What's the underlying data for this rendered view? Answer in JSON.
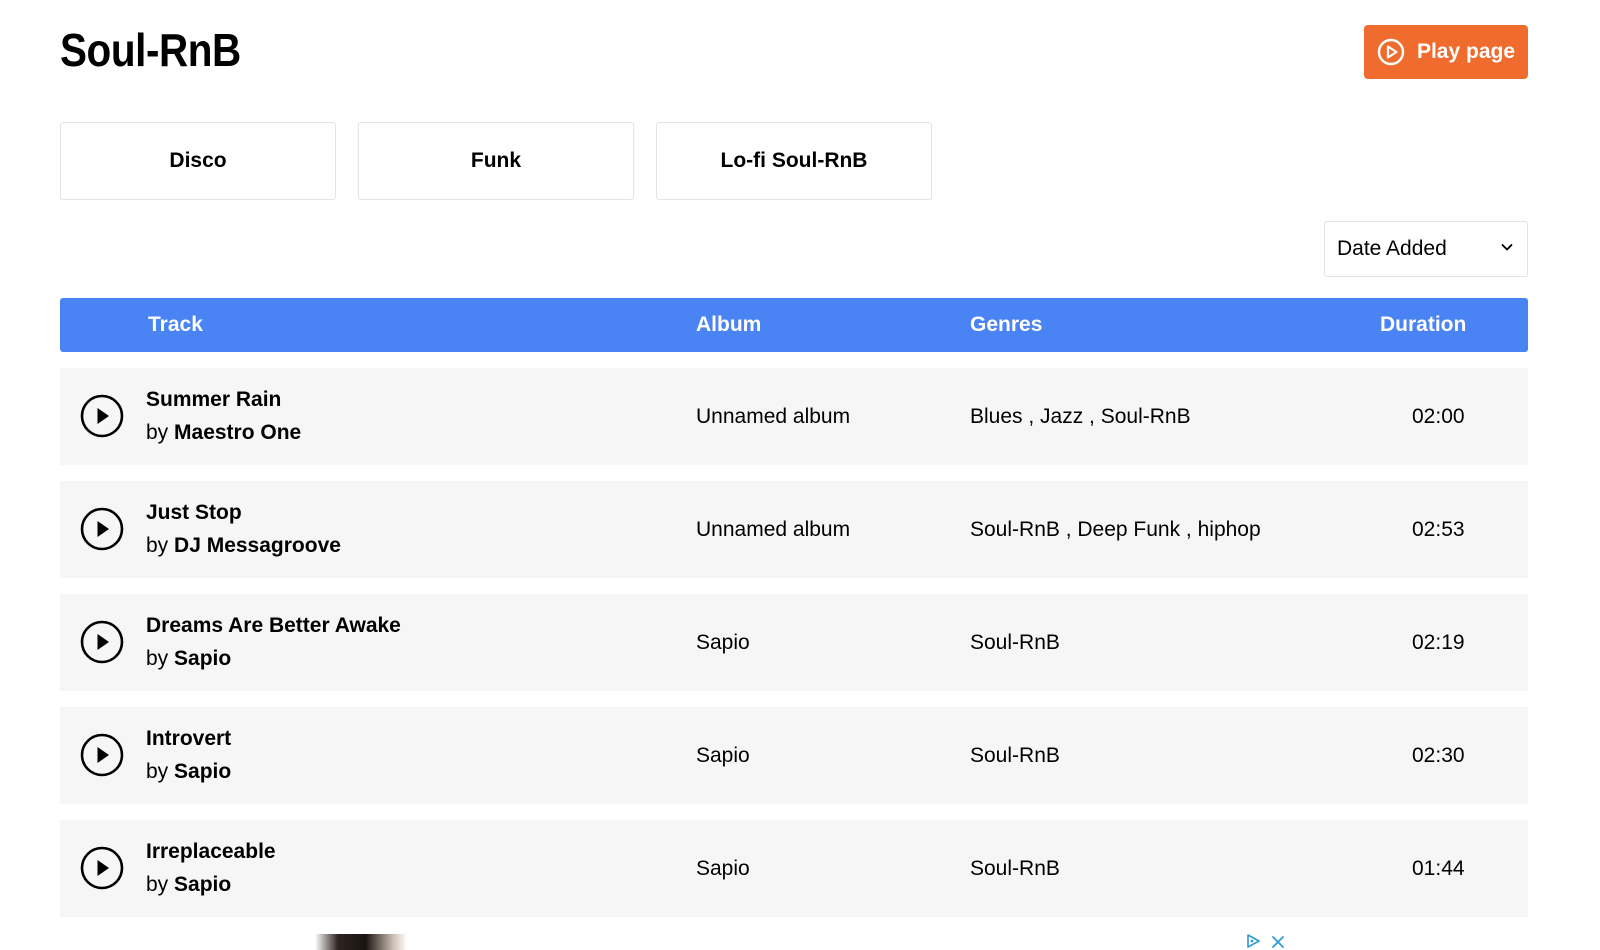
{
  "page": {
    "title": "Soul-RnB",
    "play_button_label": "Play page"
  },
  "genre_tiles": [
    "Disco",
    "Funk",
    "Lo-fi Soul-RnB"
  ],
  "sort": {
    "selected": "Date Added"
  },
  "table": {
    "columns": {
      "track": "Track",
      "album": "Album",
      "genres": "Genres",
      "duration": "Duration"
    },
    "rows": [
      {
        "track": "Summer Rain",
        "by": "by",
        "artist": "Maestro One",
        "album": "Unnamed album",
        "genres": "Blues , Jazz , Soul-RnB",
        "duration": "02:00"
      },
      {
        "track": "Just Stop",
        "by": "by",
        "artist": "DJ Messagroove",
        "album": "Unnamed album",
        "genres": "Soul-RnB , Deep Funk , hiphop",
        "duration": "02:53"
      },
      {
        "track": "Dreams Are Better Awake",
        "by": "by",
        "artist": "Sapio",
        "album": "Sapio",
        "genres": "Soul-RnB",
        "duration": "02:19"
      },
      {
        "track": "Introvert",
        "by": "by",
        "artist": "Sapio",
        "album": "Sapio",
        "genres": "Soul-RnB",
        "duration": "02:30"
      },
      {
        "track": "Irreplaceable",
        "by": "by",
        "artist": "Sapio",
        "album": "Sapio",
        "genres": "Soul-RnB",
        "duration": "01:44"
      }
    ]
  },
  "colors": {
    "accent_orange": "#f06b2e",
    "header_blue": "#4a83f4",
    "row_background": "#f6f6f6"
  },
  "icons": {
    "play_page": "play-circle-icon",
    "row_play": "play-circle-icon",
    "sort_dropdown": "chevron-down-icon",
    "ad_choices": "ad-choices-icon",
    "ad_close": "close-icon"
  }
}
